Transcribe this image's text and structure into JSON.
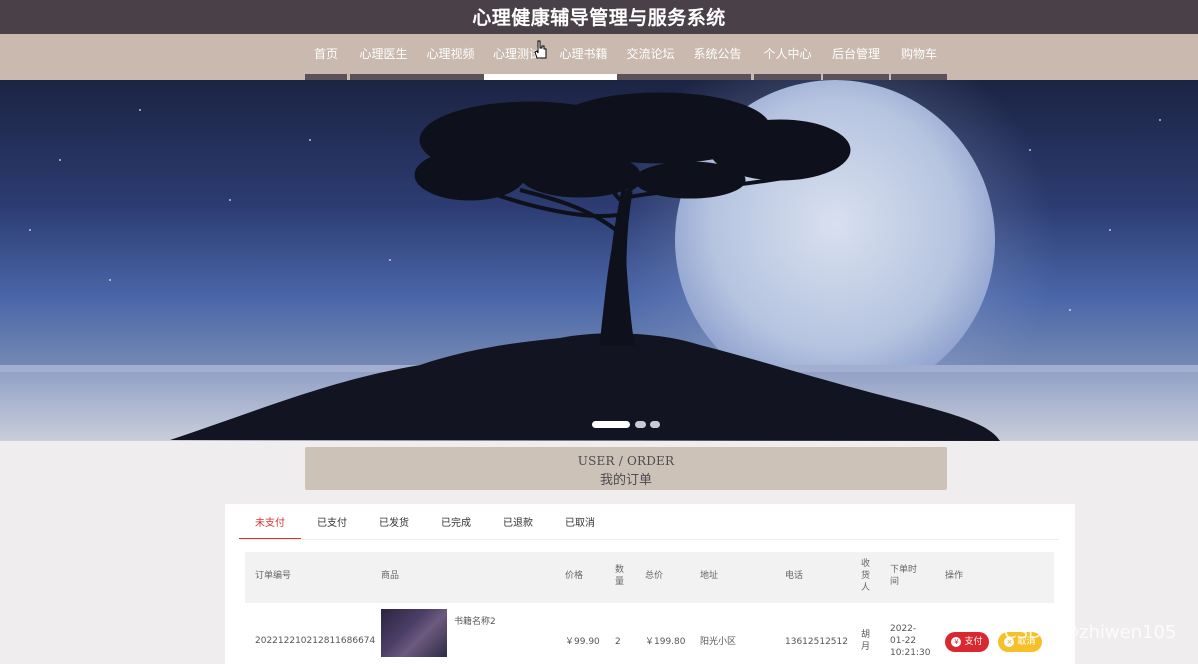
{
  "header": {
    "site_title": "心理健康辅导管理与服务系统"
  },
  "nav": {
    "items": [
      {
        "label": "首页"
      },
      {
        "label": "心理医生"
      },
      {
        "label": "心理视频"
      },
      {
        "label": "心理测试"
      },
      {
        "label": "心理书籍"
      },
      {
        "label": "交流论坛"
      },
      {
        "label": "系统公告"
      },
      {
        "label": "个人中心"
      },
      {
        "label": "后台管理"
      },
      {
        "label": "购物车"
      }
    ],
    "active_index": 3
  },
  "carousel": {
    "slide_count": 3,
    "active_index": 0
  },
  "section": {
    "title_en": "USER / ORDER",
    "title_zh": "我的订单"
  },
  "order_tabs": {
    "items": [
      "未支付",
      "已支付",
      "已发货",
      "已完成",
      "已退款",
      "已取消"
    ],
    "active_index": 0
  },
  "table": {
    "headers": {
      "order_no": "订单编号",
      "product": "商品",
      "price": "价格",
      "quantity": "数\n量",
      "total": "总价",
      "address": "地址",
      "phone": "电话",
      "receiver": "收\n货\n人",
      "order_time": "下单时\n间",
      "actions": "操作"
    },
    "rows": [
      {
        "order_no": "20221221021281168667​4",
        "product_name": "书籍名称2",
        "price": "￥99.90",
        "quantity": "2",
        "total": "￥199.80",
        "address": "阳光小区",
        "phone": "13612512512",
        "receiver": "胡\n月",
        "order_time": "2022-\n01-22\n10:21:30",
        "pay_label": "支付",
        "cancel_label": "取消"
      }
    ]
  },
  "watermark": {
    "text": "CSDN @zhiwen105"
  },
  "colors": {
    "topbar": "#4a4148",
    "navbar": "#c9b9ae",
    "accent_red": "#d2322d",
    "cancel_yellow": "#f6c02a",
    "section_box": "#ccc2b8"
  }
}
